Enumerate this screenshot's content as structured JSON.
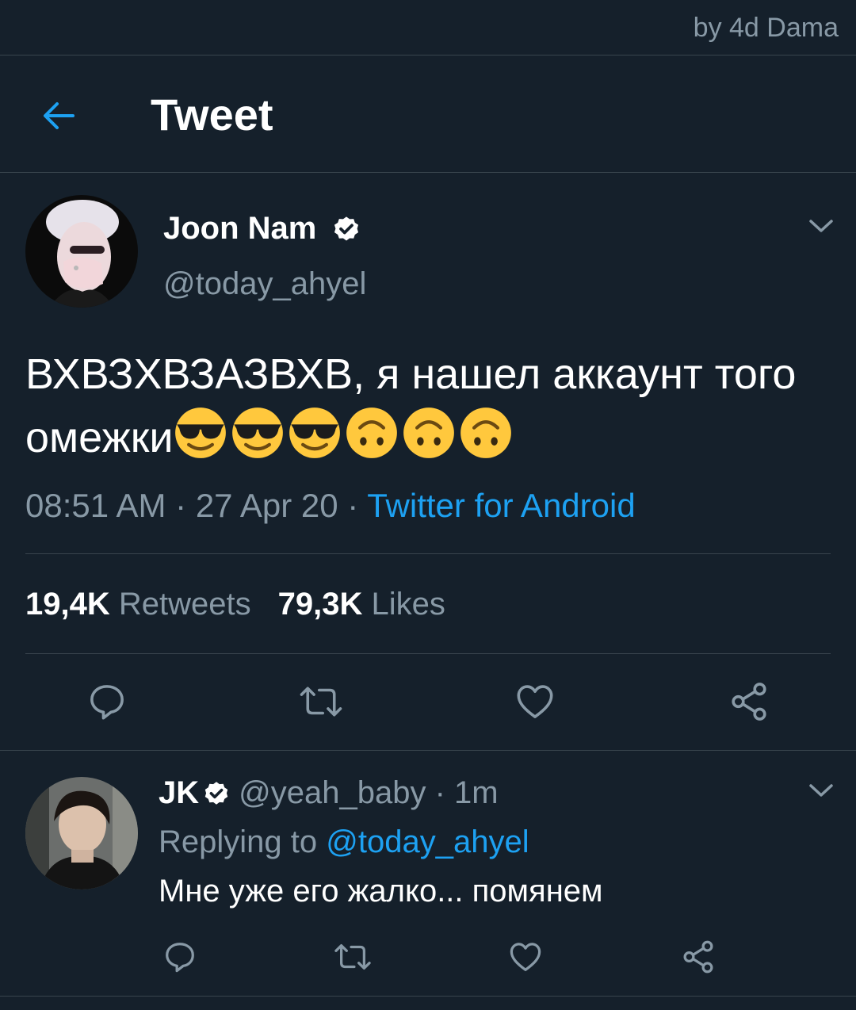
{
  "watermark": "by 4d Dama",
  "header": {
    "title": "Tweet",
    "back_icon": "arrow-left-icon"
  },
  "tweet": {
    "author_name": "Joon Nam",
    "handle": "@today_ahyel",
    "text": "ВХВЗХВЗАЗВХВ, я нашел аккаунт того омежки",
    "emojis": [
      "smiling-face-with-sunglasses",
      "smiling-face-with-sunglasses",
      "smiling-face-with-sunglasses",
      "upside-down-face",
      "upside-down-face",
      "upside-down-face"
    ],
    "time": "08:51 AM",
    "date": "27 Apr 20",
    "separator": "·",
    "source": "Twitter for Android",
    "retweets_count": "19,4K",
    "retweets_label": "Retweets",
    "likes_count": "79,3K",
    "likes_label": "Likes"
  },
  "reply": {
    "author_name": "JK",
    "handle": "@yeah_baby",
    "time": "1m",
    "separator": "·",
    "replying_label": "Replying to",
    "replying_handle": "@today_ahyel",
    "text": "Мне уже его жалко... помянем"
  },
  "colors": {
    "background": "#15202b",
    "accent": "#1da1f2",
    "muted": "#8899a6",
    "divider": "#38444d",
    "emoji_yellow": "#ffc83d"
  }
}
